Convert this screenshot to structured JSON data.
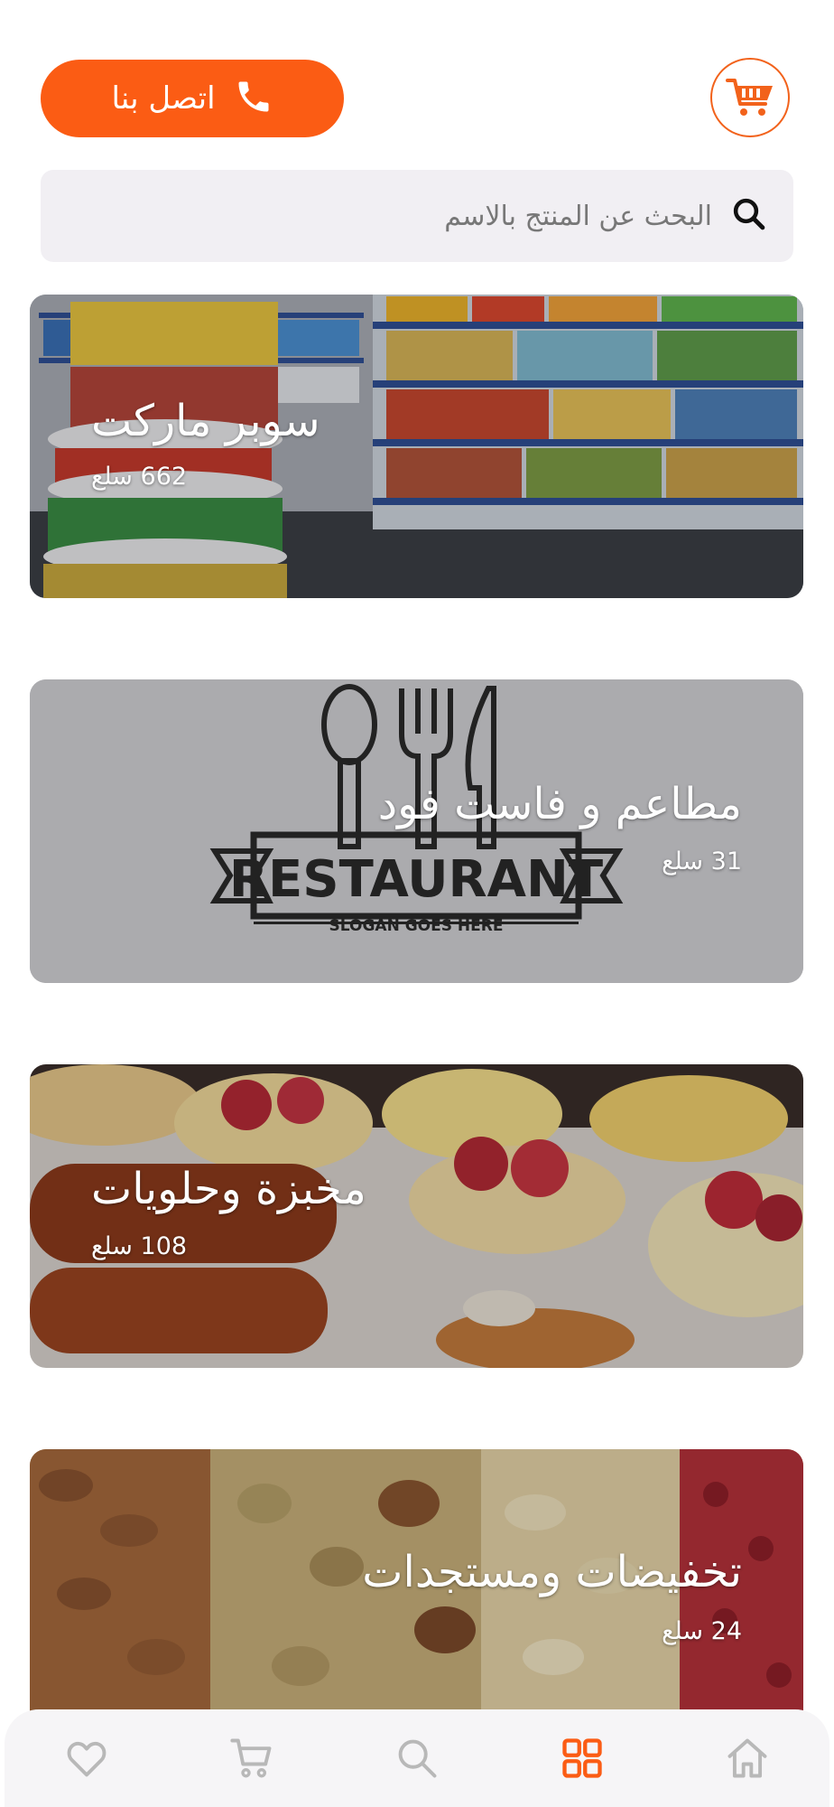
{
  "header": {
    "contact_label": "اتصل بنا",
    "logo_icon": "shopping-cart-logo-icon",
    "phone_icon": "phone-icon",
    "accent_color": "#fb5c14"
  },
  "search": {
    "placeholder": "البحث عن المنتج بالاسم",
    "icon": "search-icon"
  },
  "categories": [
    {
      "title": "سوبر ماركت",
      "count": "662 سلع"
    },
    {
      "title": "مطاعم و فاست فود",
      "count": "31 سلع",
      "image_text": "RESTAURANT",
      "image_slogan": "SLOGAN GOES HERE"
    },
    {
      "title": "مخبزة وحلويات",
      "count": "108 سلع"
    },
    {
      "title": "تخفيضات ومستجدات",
      "count": "24 سلع"
    }
  ],
  "bottom_nav": {
    "items": [
      {
        "icon": "heart-icon",
        "active": false
      },
      {
        "icon": "cart-icon",
        "active": false
      },
      {
        "icon": "search-icon",
        "active": false
      },
      {
        "icon": "grid-icon",
        "active": true
      },
      {
        "icon": "home-icon",
        "active": false
      }
    ],
    "active_color": "#fb5c14",
    "inactive_color": "#b8b8b8"
  }
}
